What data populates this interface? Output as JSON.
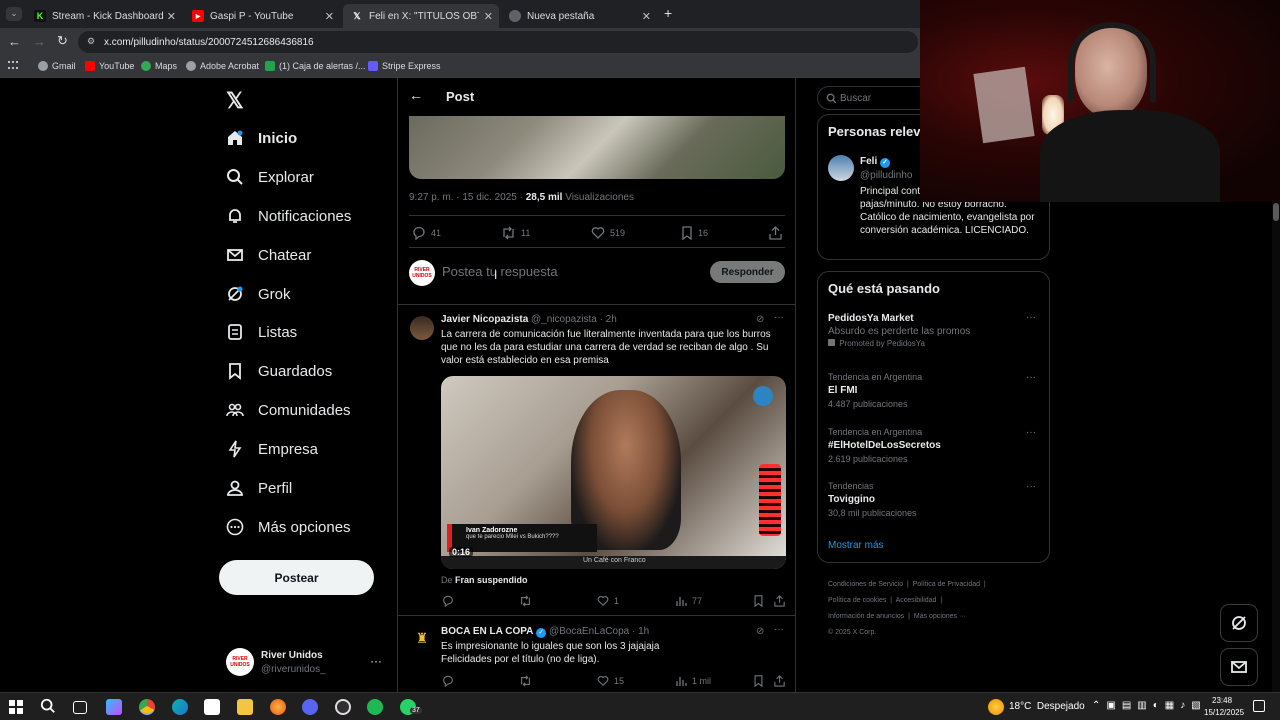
{
  "browser": {
    "tabs": [
      {
        "title": "Stream - Kick Dashboard",
        "color": "#53fc18",
        "glyph": "K"
      },
      {
        "title": "Gaspi P - YouTube",
        "color": "#ff0000",
        "glyph": "▶"
      },
      {
        "title": "Feli en X: \"TÍTULOS OBTENIDOS",
        "color": "#000000",
        "glyph": "X"
      },
      {
        "title": "Nueva pestaña",
        "color": "#5f6368",
        "glyph": "◉"
      }
    ],
    "url": "x.com/pilludinho/status/2000724512686436816",
    "bookmarks": [
      "Gmail",
      "YouTube",
      "Maps",
      "Adobe Acrobat",
      "(1) Caja de alertas /...",
      "Stripe Express"
    ]
  },
  "nav": {
    "items": [
      "Inicio",
      "Explorar",
      "Notificaciones",
      "Chatear",
      "Grok",
      "Listas",
      "Guardados",
      "Comunidades",
      "Empresa",
      "Perfil",
      "Más opciones"
    ],
    "post_label": "Postear",
    "account_name": "River Unidos",
    "account_handle": "@riverunidos_",
    "avatar_text": "RIVER UNIDOS"
  },
  "post": {
    "header": "Post",
    "timestamp": "9:27 p. m. · 15 dic. 2025 ·",
    "views_count": "28,5 mil",
    "views_label": "Visualizaciones",
    "replies": "41",
    "reposts": "11",
    "likes": "519",
    "bookmarks": "16",
    "reply_placeholder": "Postea tu respuesta",
    "reply_button": "Responder"
  },
  "replies": [
    {
      "name": "Javier Nicopazista",
      "handle": "@_nicopazista · 2h",
      "text": "La carrera de comunicación fue literalmente inventada para que los burros que no les da para estudiar una carrera de verdad se reciban de algo . Su valor está establecido en esa premisa",
      "video_duration": "0:16",
      "video_caption_name": "Ivan Zadorozne",
      "video_caption_text": "que te parecio Milei vs Bukich????",
      "video_footer": "Un Café con Franco",
      "from_prefix": "De",
      "from_name": "Fran suspendido",
      "likes": "1",
      "views": "77"
    },
    {
      "name": "BOCA EN LA COPA",
      "handle": "@BocaEnLaCopa · 1h",
      "text": "Es impresionante lo iguales que son los 3 jajajaja\nFelicidades por el título (no de liga).",
      "likes": "15",
      "views": "1 mil"
    }
  ],
  "sidebar": {
    "search_placeholder": "Buscar",
    "relevant_title": "Personas relevantes",
    "person_name": "Feli",
    "person_handle": "@pilludinho",
    "person_bio": "Principal contribuidor al ratio pajas/minuto. No estoy borracho. Católico de nacimiento, evangelista por conversión académica. LICENCIADO.",
    "trending_title": "Qué está pasando",
    "trends": [
      {
        "context": "",
        "name": "PedidosYa Market",
        "detail": "Absurdo es perderte las promos",
        "promoted": "Promoted by PedidosYa"
      },
      {
        "context": "Tendencia en Argentina",
        "name": "El FMI",
        "detail": "4.487 publicaciones"
      },
      {
        "context": "Tendencia en Argentina",
        "name": "#ElHotelDeLosSecretos",
        "detail": "2.619 publicaciones"
      },
      {
        "context": "Tendencias",
        "name": "Toviggino",
        "detail": "30,8 mil publicaciones"
      }
    ],
    "show_more": "Mostrar más",
    "footer": [
      "Condiciones de Servicio",
      "Política de Privacidad",
      "Política de cookies",
      "Accesibilidad",
      "Información de anuncios",
      "Más opciones ···",
      "© 2025 X Corp."
    ]
  },
  "taskbar": {
    "weather": "18°C  Despejado",
    "time": "23:48",
    "date": "15/12/2025",
    "badge": "37"
  },
  "colors": {
    "accent": "#1d9bf0",
    "verified": "#1d9bf0"
  }
}
